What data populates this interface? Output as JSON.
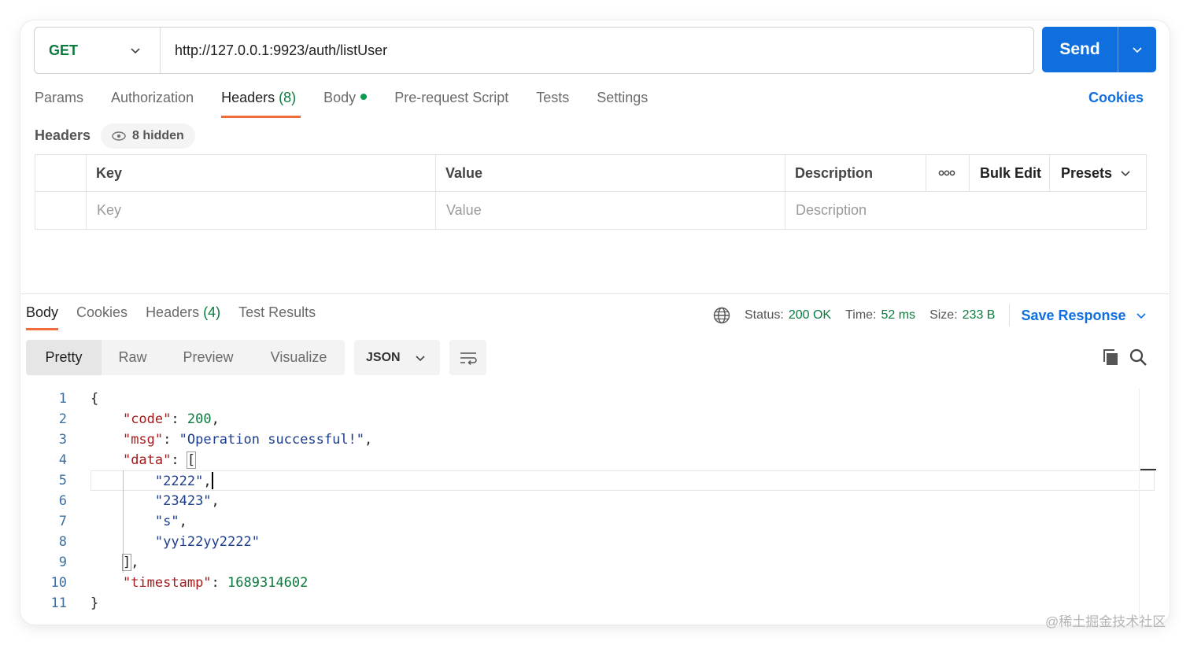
{
  "request": {
    "method": "GET",
    "url": "http://127.0.0.1:9923/auth/listUser",
    "send_label": "Send",
    "tabs": [
      {
        "label": "Params",
        "count": ""
      },
      {
        "label": "Authorization",
        "count": ""
      },
      {
        "label": "Headers",
        "count": "(8)"
      },
      {
        "label": "Body",
        "count": ""
      },
      {
        "label": "Pre-request Script",
        "count": ""
      },
      {
        "label": "Tests",
        "count": ""
      },
      {
        "label": "Settings",
        "count": ""
      }
    ],
    "cookies_label": "Cookies"
  },
  "headers": {
    "label": "Headers",
    "hidden_label": "8 hidden",
    "columns": {
      "key": "Key",
      "value": "Value",
      "description": "Description",
      "bulk_edit": "Bulk Edit",
      "presets": "Presets"
    },
    "placeholder": {
      "key": "Key",
      "value": "Value",
      "description": "Description"
    }
  },
  "response": {
    "tabs": [
      {
        "label": "Body",
        "count": ""
      },
      {
        "label": "Cookies",
        "count": ""
      },
      {
        "label": "Headers",
        "count": "(4)"
      },
      {
        "label": "Test Results",
        "count": ""
      }
    ],
    "status_label": "Status:",
    "status_value": "200 OK",
    "time_label": "Time:",
    "time_value": "52 ms",
    "size_label": "Size:",
    "size_value": "233 B",
    "save_label": "Save Response",
    "view_modes": [
      "Pretty",
      "Raw",
      "Preview",
      "Visualize"
    ],
    "format": "JSON"
  },
  "code_lines": [
    {
      "num": "1"
    },
    {
      "num": "2"
    },
    {
      "num": "3"
    },
    {
      "num": "4"
    },
    {
      "num": "5"
    },
    {
      "num": "6"
    },
    {
      "num": "7"
    },
    {
      "num": "8"
    },
    {
      "num": "9"
    },
    {
      "num": "10"
    },
    {
      "num": "11"
    }
  ],
  "json_body": {
    "open_brace": "{",
    "code_key": "\"code\"",
    "code_val": "200",
    "msg_key": "\"msg\"",
    "msg_val": "\"Operation successful!\"",
    "data_key": "\"data\"",
    "open_bracket": "[",
    "item1": "\"2222\"",
    "item2": "\"23423\"",
    "item3": "\"s\"",
    "item4": "\"yyi22yy2222\"",
    "close_bracket": "]",
    "ts_key": "\"timestamp\"",
    "ts_val": "1689314602",
    "close_brace": "}"
  },
  "watermark": "@稀土掘金技术社区",
  "colors": {
    "accent": "#0f6fde",
    "tab_underline": "#f26b3a",
    "success": "#0a7a3e",
    "json_key": "#a11d1d"
  }
}
